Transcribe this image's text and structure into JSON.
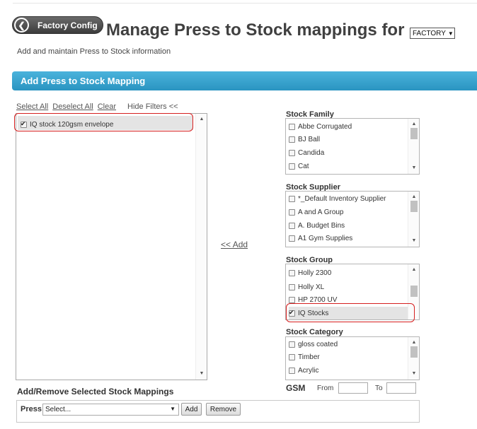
{
  "header": {
    "back_label": "Factory Config",
    "title": "Manage Press to Stock mappings for",
    "factory_select": "FACTORY",
    "subtitle": "Add and maintain Press to Stock information"
  },
  "panel": {
    "title": "Add Press to Stock Mapping"
  },
  "filters": {
    "select_all": "Select All",
    "deselect_all": "Deselect All",
    "clear": "Clear",
    "hide_filters": "Hide Filters <<"
  },
  "stock_list": {
    "items": [
      {
        "label": "IQ stock 120gsm envelope",
        "checked": true
      }
    ]
  },
  "add_link": "<< Add",
  "stock_family": {
    "label": "Stock Family",
    "options": [
      "Abbe Corrugated",
      "BJ Ball",
      "Candida",
      "Cat"
    ]
  },
  "stock_supplier": {
    "label": "Stock Supplier",
    "options": [
      "*_Default Inventory Supplier",
      "A and A Group",
      "A. Budget Bins",
      "A1 Gym Supplies"
    ]
  },
  "stock_group": {
    "label": "Stock Group",
    "options": [
      "Holly 2300",
      "Holly XL",
      "HP 2700 UV",
      "IQ Stocks"
    ],
    "checked": "IQ Stocks"
  },
  "stock_category": {
    "label": "Stock Category",
    "options": [
      "gloss coated",
      "Timber",
      "Acrylic"
    ]
  },
  "gsm": {
    "label": "GSM",
    "from_label": "From",
    "to_label": "To",
    "from_value": "",
    "to_value": ""
  },
  "mappings": {
    "title": "Add/Remove Selected Stock Mappings",
    "press_label": "Press",
    "press_select": "Select...",
    "add_button": "Add",
    "remove_button": "Remove"
  },
  "colors": {
    "accent_bar": "#3aa3cf",
    "highlight_outline": "#d61f1f"
  }
}
